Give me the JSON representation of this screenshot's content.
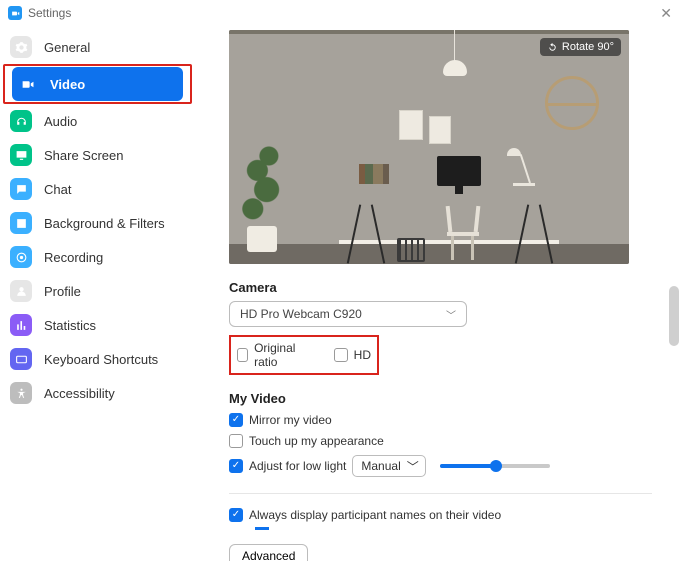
{
  "window": {
    "title": "Settings"
  },
  "sidebar": {
    "items": [
      {
        "label": "General"
      },
      {
        "label": "Video"
      },
      {
        "label": "Audio"
      },
      {
        "label": "Share Screen"
      },
      {
        "label": "Chat"
      },
      {
        "label": "Background & Filters"
      },
      {
        "label": "Recording"
      },
      {
        "label": "Profile"
      },
      {
        "label": "Statistics"
      },
      {
        "label": "Keyboard Shortcuts"
      },
      {
        "label": "Accessibility"
      }
    ]
  },
  "preview": {
    "rotate_label": "Rotate 90°"
  },
  "camera": {
    "heading": "Camera",
    "selected": "HD Pro Webcam C920",
    "original_ratio_label": "Original ratio",
    "hd_label": "HD"
  },
  "myvideo": {
    "heading": "My Video",
    "mirror_label": "Mirror my video",
    "touchup_label": "Touch up my appearance",
    "lowlight_label": "Adjust for low light",
    "lowlight_mode": "Manual"
  },
  "participant_names_label": "Always display participant names on their video",
  "advanced_label": "Advanced"
}
